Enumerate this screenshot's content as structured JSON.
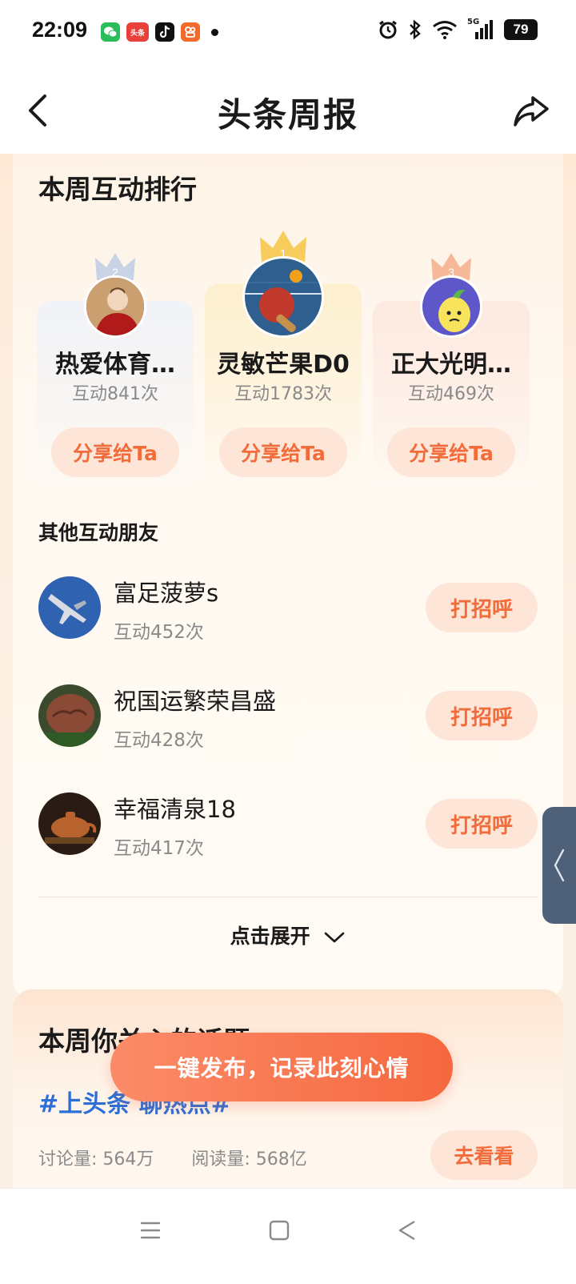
{
  "status_bar": {
    "time": "22:09",
    "notification_apps": [
      "wechat-icon",
      "toutiao-icon",
      "douyin-icon",
      "kuaishou-icon"
    ],
    "app_badge_text": "头条",
    "network": "5G",
    "battery": "79"
  },
  "nav": {
    "title": "头条周报",
    "back_icon": "chevron-left-icon",
    "share_icon": "share-icon"
  },
  "ranking": {
    "title": "本周互动排行",
    "podium": [
      {
        "rank": "2",
        "name": "热爱体育…",
        "count": "互动841次",
        "button": "分享给Ta"
      },
      {
        "rank": "1",
        "name": "灵敏芒果D0",
        "count": "互动1783次",
        "button": "分享给Ta"
      },
      {
        "rank": "3",
        "name": "正大光明…",
        "count": "互动469次",
        "button": "分享给Ta"
      }
    ],
    "others_title": "其他互动朋友",
    "others": [
      {
        "name": "富足菠萝s",
        "count": "互动452次",
        "button": "打招呼"
      },
      {
        "name": "祝国运繁荣昌盛",
        "count": "互动428次",
        "button": "打招呼"
      },
      {
        "name": "幸福清泉18",
        "count": "互动417次",
        "button": "打招呼"
      }
    ],
    "expand_label": "点击展开"
  },
  "topics": {
    "title": "本周你关心的话题",
    "tag": "#上头条 聊热点#",
    "discussion": "讨论量: 564万",
    "reads": "阅读量: 568亿",
    "go_button": "去看看"
  },
  "publish_button": "一键发布，记录此刻心情",
  "colors": {
    "accent": "#f26b3a",
    "accent_bg": "#fde6d8",
    "topic_blue": "#2c6fd6",
    "side_tab": "#4f6179"
  }
}
